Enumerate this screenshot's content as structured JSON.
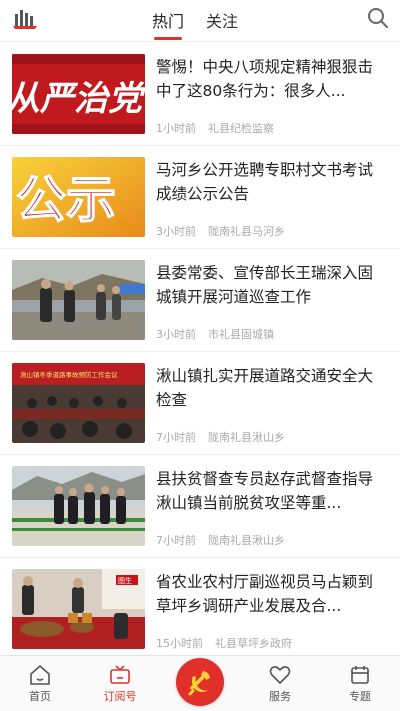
{
  "header": {
    "tabs": [
      {
        "label": "热门",
        "active": true
      },
      {
        "label": "关注",
        "active": false
      }
    ],
    "icons": {
      "logo": "app-logo",
      "search": "search-icon"
    }
  },
  "news": [
    {
      "title": "警惕！中央八项规定精神狠狠击中了这80条行为：很多人...",
      "time": "1小时前",
      "source": "礼县纪检监察",
      "thumb_text": "从严治党"
    },
    {
      "title": "马河乡公开选聘专职村文书考试成绩公示公告",
      "time": "3小时前",
      "source": "陇南礼县马河乡",
      "thumb_text": "公示"
    },
    {
      "title": "县委常委、宣传部长王瑞深入固城镇开展河道巡查工作",
      "time": "3小时前",
      "source": "市礼县固城镇"
    },
    {
      "title": "湫山镇扎实开展道路交通安全大检查",
      "time": "7小时前",
      "source": "陇南礼县湫山乡",
      "thumb_text": "湫山镇冬季道路事故预防工作会议"
    },
    {
      "title": "县扶贫督查专员赵存武督查指导湫山镇当前脱贫攻坚等重...",
      "time": "7小时前",
      "source": "陇南礼县湫山乡"
    },
    {
      "title": "省农业农村厅副巡视员马占颖到草坪乡调研产业发展及合...",
      "time": "15小时前",
      "source": "礼县草坪乡政府",
      "thumb_text": "图生"
    }
  ],
  "bottom_nav": [
    {
      "label": "首页",
      "icon": "home-icon",
      "active": false
    },
    {
      "label": "订阅号",
      "icon": "tv-icon",
      "active": true
    },
    {
      "label": "",
      "icon": "party-emblem-icon",
      "active": false
    },
    {
      "label": "服务",
      "icon": "heart-icon",
      "active": false
    },
    {
      "label": "专题",
      "icon": "calendar-icon",
      "active": false
    }
  ],
  "colors": {
    "accent": "#d9342b",
    "meta": "#aaaaaa"
  }
}
